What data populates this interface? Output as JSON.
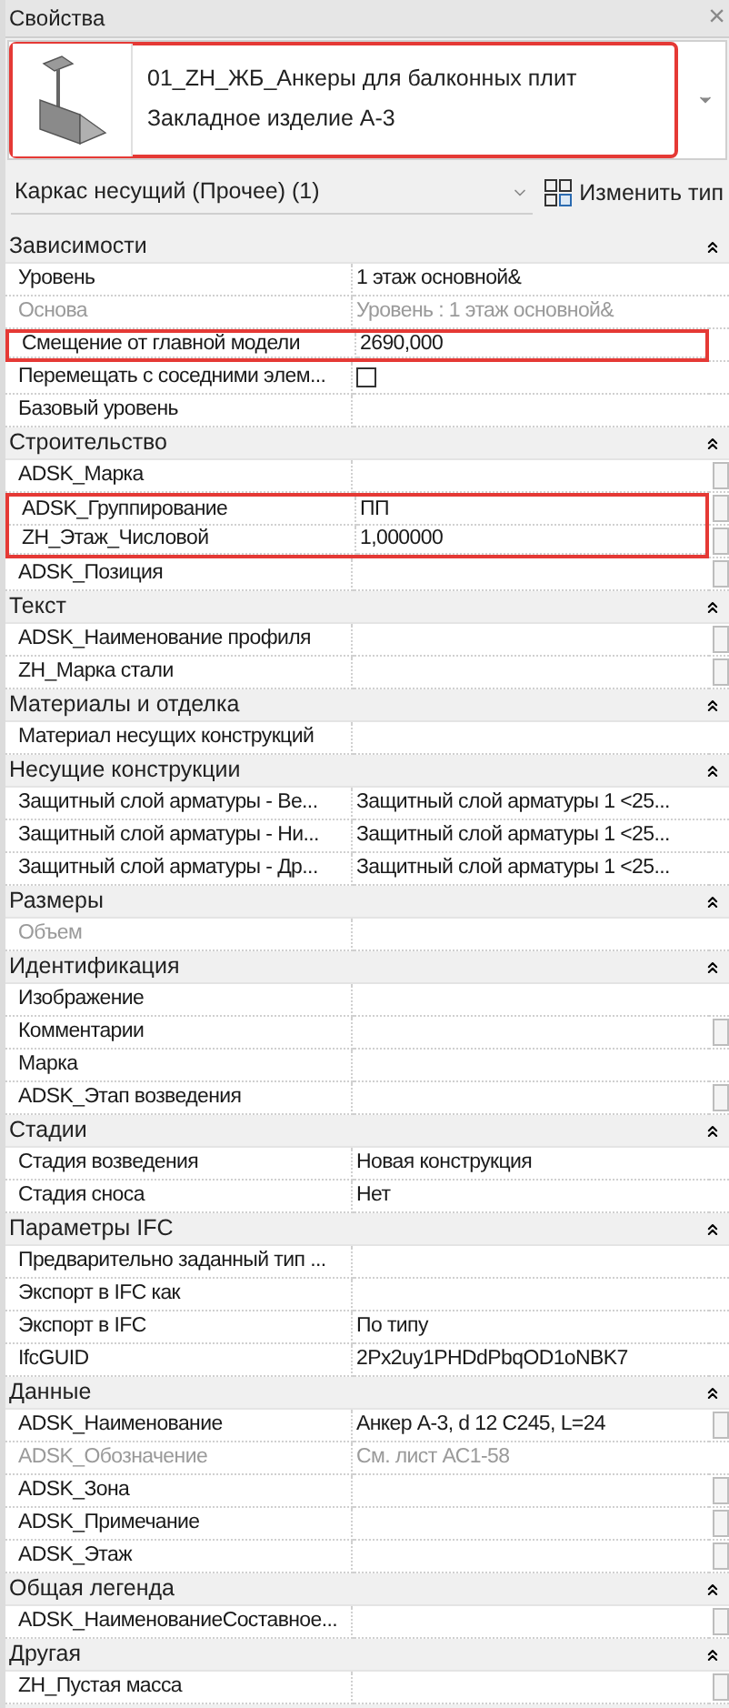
{
  "panel": {
    "title": "Свойства",
    "close": "×"
  },
  "type_selector": {
    "family": "01_ZH_ЖБ_Анкеры для балконных плит",
    "type": "Закладное изделие А-3",
    "highlighted": true
  },
  "filter": {
    "value": "Каркас несущий (Прочее) (1)",
    "edit_type": "Изменить тип"
  },
  "sections": [
    {
      "title": "Зависимости",
      "expanded": true,
      "rows": [
        {
          "kind": "text",
          "label": "Уровень",
          "value": "1 этаж основной&",
          "disabled": false,
          "highlighted": false,
          "button": false
        },
        {
          "kind": "text",
          "label": "Основа",
          "value": "Уровень : 1 этаж основной&",
          "disabled": true,
          "highlighted": false,
          "button": false
        },
        {
          "kind": "text",
          "label": "Смещение от главной модели",
          "value": "2690,000",
          "disabled": false,
          "highlighted": true,
          "button": false
        },
        {
          "kind": "checkbox",
          "label": "Перемещать с соседними элем...",
          "checked": false,
          "disabled": false,
          "highlighted": false,
          "button": false
        },
        {
          "kind": "text",
          "label": "Базовый уровень",
          "disabled": false,
          "highlighted": false,
          "button": false
        }
      ]
    },
    {
      "title": "Строительство",
      "expanded": true,
      "rows": [
        {
          "kind": "text",
          "label": "ADSK_Марка",
          "disabled": false,
          "highlighted": false,
          "button": true
        },
        {
          "kind": "text",
          "label": "ADSK_Группирование",
          "value": "ПП",
          "disabled": false,
          "highlighted": true,
          "button": true
        },
        {
          "kind": "text",
          "label": "ZH_Этаж_Числовой",
          "value": "1,000000",
          "disabled": false,
          "highlighted": true,
          "button": true
        },
        {
          "kind": "text",
          "label": "ADSK_Позиция",
          "disabled": false,
          "highlighted": false,
          "button": true
        }
      ]
    },
    {
      "title": "Текст",
      "expanded": true,
      "rows": [
        {
          "kind": "text",
          "label": "ADSK_Наименование профиля",
          "disabled": false,
          "highlighted": false,
          "button": true
        },
        {
          "kind": "text",
          "label": "ZH_Марка стали",
          "disabled": false,
          "highlighted": false,
          "button": true
        }
      ]
    },
    {
      "title": "Материалы и отделка",
      "expanded": true,
      "rows": [
        {
          "kind": "text",
          "label": "Материал несущих конструкций",
          "disabled": false,
          "highlighted": false,
          "button": false
        }
      ]
    },
    {
      "title": "Несущие конструкции",
      "expanded": true,
      "rows": [
        {
          "kind": "text",
          "label": "Защитный слой арматуры - Ве...",
          "value": "Защитный слой арматуры 1 <25...",
          "disabled": false,
          "highlighted": false,
          "button": false
        },
        {
          "kind": "text",
          "label": "Защитный слой арматуры - Ни...",
          "value": "Защитный слой арматуры 1 <25...",
          "disabled": false,
          "highlighted": false,
          "button": false
        },
        {
          "kind": "text",
          "label": "Защитный слой арматуры - Др...",
          "value": "Защитный слой арматуры 1 <25...",
          "disabled": false,
          "highlighted": false,
          "button": false
        }
      ]
    },
    {
      "title": "Размеры",
      "expanded": true,
      "rows": [
        {
          "kind": "text",
          "label": "Объем",
          "disabled": true,
          "highlighted": false,
          "button": false
        }
      ]
    },
    {
      "title": "Идентификация",
      "expanded": true,
      "rows": [
        {
          "kind": "text",
          "label": "Изображение",
          "disabled": false,
          "highlighted": false,
          "button": false
        },
        {
          "kind": "text",
          "label": "Комментарии",
          "disabled": false,
          "highlighted": false,
          "button": true
        },
        {
          "kind": "text",
          "label": "Марка",
          "disabled": false,
          "highlighted": false,
          "button": false
        },
        {
          "kind": "text",
          "label": "ADSK_Этап возведения",
          "disabled": false,
          "highlighted": false,
          "button": true
        }
      ]
    },
    {
      "title": "Стадии",
      "expanded": true,
      "rows": [
        {
          "kind": "text",
          "label": "Стадия возведения",
          "value": "Новая конструкция",
          "disabled": false,
          "highlighted": false,
          "button": false
        },
        {
          "kind": "text",
          "label": "Стадия сноса",
          "value": "Нет",
          "disabled": false,
          "highlighted": false,
          "button": false
        }
      ]
    },
    {
      "title": "Параметры IFC",
      "expanded": true,
      "rows": [
        {
          "kind": "text",
          "label": "Предварительно заданный тип ...",
          "disabled": false,
          "highlighted": false,
          "button": false
        },
        {
          "kind": "text",
          "label": "Экспорт в IFC как",
          "disabled": false,
          "highlighted": false,
          "button": false
        },
        {
          "kind": "text",
          "label": "Экспорт в IFC",
          "value": "По типу",
          "disabled": false,
          "highlighted": false,
          "button": false
        },
        {
          "kind": "text",
          "label": "IfcGUID",
          "value": "2Px2uy1PHDdPbqOD1oNBK7",
          "disabled": false,
          "highlighted": false,
          "button": false
        }
      ]
    },
    {
      "title": "Данные",
      "expanded": true,
      "rows": [
        {
          "kind": "text",
          "label": "ADSK_Наименование",
          "value": "Анкер А-3, d 12 С245, L=24",
          "disabled": false,
          "highlighted": false,
          "button": true
        },
        {
          "kind": "text",
          "label": "ADSK_Обозначение",
          "value": "См. лист АС1-58",
          "disabled": true,
          "highlighted": false,
          "button": false
        },
        {
          "kind": "text",
          "label": "ADSK_Зона",
          "disabled": false,
          "highlighted": false,
          "button": true
        },
        {
          "kind": "text",
          "label": "ADSK_Примечание",
          "disabled": false,
          "highlighted": false,
          "button": true
        },
        {
          "kind": "text",
          "label": "ADSK_Этаж",
          "disabled": false,
          "highlighted": false,
          "button": true
        }
      ]
    },
    {
      "title": "Общая легенда",
      "expanded": true,
      "rows": [
        {
          "kind": "text",
          "label": "ADSK_НаименованиеСоставное...",
          "disabled": false,
          "highlighted": false,
          "button": true
        }
      ]
    },
    {
      "title": "Другая",
      "expanded": true,
      "rows": [
        {
          "kind": "text",
          "label": "ZH_Пустая масса",
          "disabled": false,
          "highlighted": false,
          "button": true
        }
      ]
    }
  ]
}
